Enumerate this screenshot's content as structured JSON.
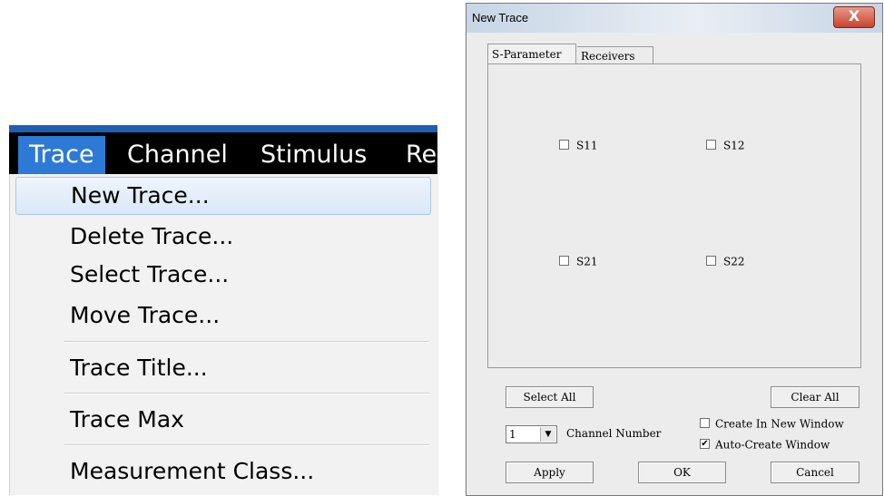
{
  "menu": {
    "menubar": [
      "Trace",
      "Channel",
      "Stimulus",
      "Re"
    ],
    "active_index": 0,
    "items": [
      {
        "label": "New Trace..."
      },
      {
        "label": "Delete Trace..."
      },
      {
        "label": "Select Trace..."
      },
      {
        "label": "Move Trace..."
      },
      {
        "label": "Trace Title..."
      },
      {
        "label": "Trace Max"
      },
      {
        "label": "Measurement Class..."
      }
    ],
    "highlighted": "New Trace..."
  },
  "dialog": {
    "title": "New Trace",
    "close_label": "X",
    "tabs": [
      {
        "label": "S-Parameter",
        "selected": true
      },
      {
        "label": "Receivers",
        "selected": false
      }
    ],
    "params": [
      {
        "label": "S11",
        "checked": false
      },
      {
        "label": "S12",
        "checked": false
      },
      {
        "label": "S21",
        "checked": false
      },
      {
        "label": "S22",
        "checked": false
      }
    ],
    "select_all": "Select All",
    "clear_all": "Clear All",
    "channel_value": "1",
    "channel_label": "Channel Number",
    "create_in_new_window": {
      "label": "Create In New Window",
      "checked": false
    },
    "auto_create_window": {
      "label": "Auto-Create Window",
      "checked": true
    },
    "apply": "Apply",
    "ok": "OK",
    "cancel": "Cancel"
  }
}
